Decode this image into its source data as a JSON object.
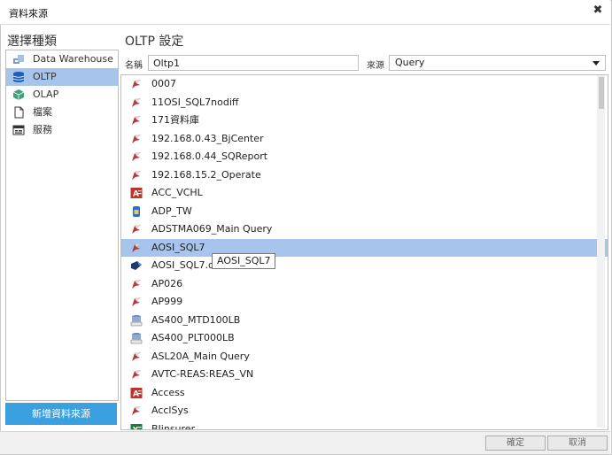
{
  "window": {
    "title": "資料來源",
    "close_glyph": "✖"
  },
  "left": {
    "heading": "選擇種類",
    "types": [
      {
        "label": "Data Warehouse",
        "icon": "data-warehouse-icon"
      },
      {
        "label": "OLTP",
        "icon": "database-icon"
      },
      {
        "label": "OLAP",
        "icon": "cube-icon"
      },
      {
        "label": "檔案",
        "icon": "file-icon"
      },
      {
        "label": "服務",
        "icon": "service-icon"
      }
    ],
    "add_button": "新增資料來源"
  },
  "right": {
    "heading": "OLTP 設定",
    "name_label": "名稱",
    "name_value": "Oltp1",
    "source_label": "來源",
    "source_value": "Query",
    "connections": [
      {
        "label": "0007",
        "icon": "sql-server-icon"
      },
      {
        "label": "11OSI_SQL7nodiff",
        "icon": "sql-server-icon"
      },
      {
        "label": "171資料庫",
        "icon": "sql-server-icon"
      },
      {
        "label": "192.168.0.43_BjCenter",
        "icon": "sql-server-icon"
      },
      {
        "label": "192.168.0.44_SQReport",
        "icon": "sql-server-icon"
      },
      {
        "label": "192.168.15.2_Operate",
        "icon": "sql-server-icon"
      },
      {
        "label": "ACC_VCHL",
        "icon": "access-icon"
      },
      {
        "label": "ADP_TW",
        "icon": "db2-icon"
      },
      {
        "label": "ADSTMA069_Main Query",
        "icon": "sql-server-icon"
      },
      {
        "label": "AOSI_SQL7",
        "icon": "sql-server-icon"
      },
      {
        "label": "AOSI_SQL7.c",
        "icon": "odbc-icon"
      },
      {
        "label": "AP026",
        "icon": "sql-server-icon"
      },
      {
        "label": "AP999",
        "icon": "sql-server-icon"
      },
      {
        "label": "AS400_MTD100LB",
        "icon": "cobol-icon"
      },
      {
        "label": "AS400_PLT000LB",
        "icon": "cobol-icon"
      },
      {
        "label": "ASL20A_Main Query",
        "icon": "sql-server-icon"
      },
      {
        "label": "AVTC-REAS:REAS_VN",
        "icon": "sql-server-icon"
      },
      {
        "label": "Access",
        "icon": "access-icon"
      },
      {
        "label": "AcclSys",
        "icon": "sql-server-icon"
      },
      {
        "label": "BIinsurer",
        "icon": "excel-icon"
      }
    ],
    "tooltip": "AOSI_SQL7"
  },
  "footer": {
    "ok": "確定",
    "cancel": "取消"
  },
  "colors": {
    "selection": "#a7c4ec",
    "add_button": "#3aa0e0"
  }
}
